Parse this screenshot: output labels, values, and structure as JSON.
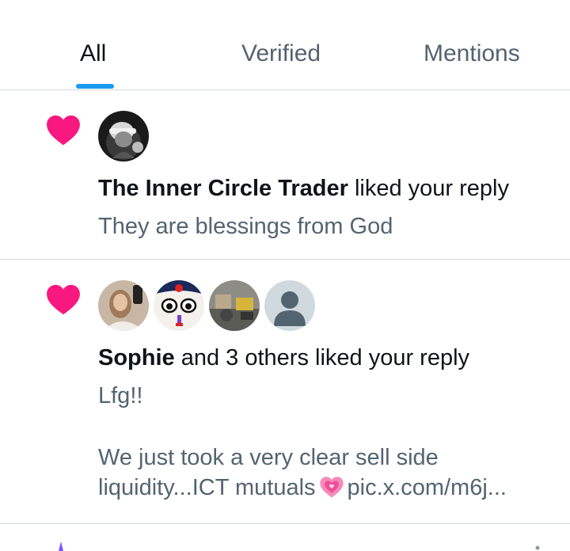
{
  "tabs": {
    "all": "All",
    "verified": "Verified",
    "mentions": "Mentions",
    "active": "All"
  },
  "colors": {
    "heart": "#f91880",
    "accent": "#1d9bf0",
    "secondary_text": "#536471",
    "primary_text": "#0f1419",
    "divider": "#cfd9de"
  },
  "notifications": [
    {
      "icon": "heart-icon",
      "actor": "The Inner Circle Trader",
      "action": " liked your reply",
      "snippet": "They are blessings from God"
    },
    {
      "icon": "heart-icon",
      "actor": "Sophie",
      "action": " and 3 others liked your reply",
      "snippet_line1": "Lfg!!",
      "snippet_line2": "We just took a very clear sell side",
      "snippet_line3_pre": "liquidity...ICT mutuals",
      "snippet_line3_emoji": "growing-heart-icon",
      "snippet_line3_link": "pic.x.com/m6j..."
    }
  ]
}
